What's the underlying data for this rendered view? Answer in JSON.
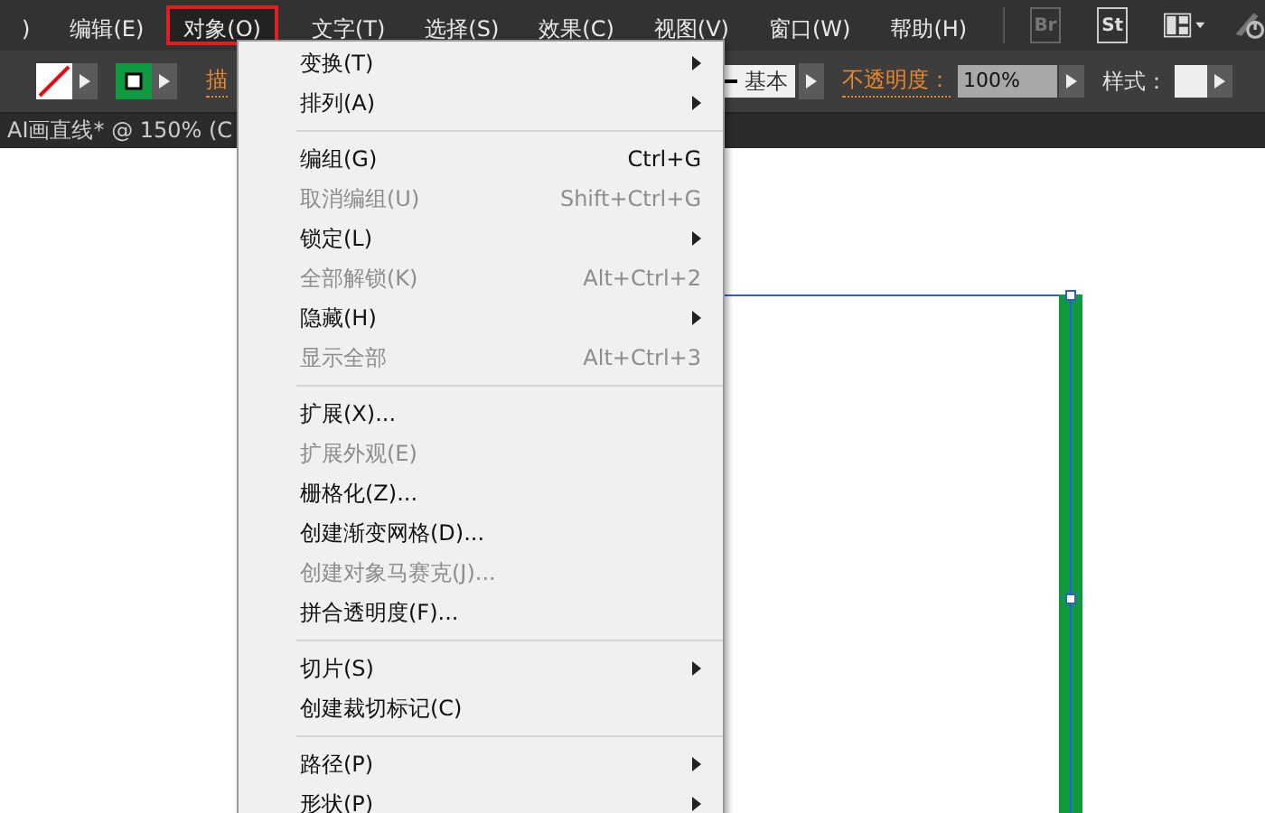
{
  "menubar": {
    "items": [
      {
        "label": ")",
        "selected": false
      },
      {
        "label": "编辑(E)",
        "selected": false
      },
      {
        "label": "对象(O)",
        "selected": true
      },
      {
        "label": "文字(T)",
        "selected": false
      },
      {
        "label": "选择(S)",
        "selected": false
      },
      {
        "label": "效果(C)",
        "selected": false
      },
      {
        "label": "视图(V)",
        "selected": false
      },
      {
        "label": "窗口(W)",
        "selected": false
      },
      {
        "label": "帮助(H)",
        "selected": false
      }
    ],
    "bridge_label": "Br",
    "stock_label": "St"
  },
  "control_bar": {
    "stroke_label": "描",
    "brush": "基本",
    "opacity_label": "不透明度：",
    "opacity_value": "100%",
    "style_label": "样式："
  },
  "document_tab": {
    "title": "AI画直线* @ 150% (C"
  },
  "menu": {
    "groups": [
      [
        {
          "label": "变换(T)",
          "disabled": false,
          "submenu": true
        },
        {
          "label": "排列(A)",
          "disabled": false,
          "submenu": true
        }
      ],
      [
        {
          "label": "编组(G)",
          "shortcut": "Ctrl+G",
          "disabled": false,
          "submenu": false
        },
        {
          "label": "取消编组(U)",
          "shortcut": "Shift+Ctrl+G",
          "disabled": true,
          "submenu": false
        },
        {
          "label": "锁定(L)",
          "disabled": false,
          "submenu": true
        },
        {
          "label": "全部解锁(K)",
          "shortcut": "Alt+Ctrl+2",
          "disabled": true,
          "submenu": false
        },
        {
          "label": "隐藏(H)",
          "disabled": false,
          "submenu": true
        },
        {
          "label": "显示全部",
          "shortcut": "Alt+Ctrl+3",
          "disabled": true,
          "submenu": false
        }
      ],
      [
        {
          "label": "扩展(X)...",
          "disabled": false,
          "submenu": false
        },
        {
          "label": "扩展外观(E)",
          "disabled": true,
          "submenu": false
        },
        {
          "label": "栅格化(Z)...",
          "disabled": false,
          "submenu": false
        },
        {
          "label": "创建渐变网格(D)...",
          "disabled": false,
          "submenu": false
        },
        {
          "label": "创建对象马赛克(J)...",
          "disabled": true,
          "submenu": false
        },
        {
          "label": "拼合透明度(F)...",
          "disabled": false,
          "submenu": false
        }
      ],
      [
        {
          "label": "切片(S)",
          "disabled": false,
          "submenu": true
        },
        {
          "label": "创建裁切标记(C)",
          "disabled": false,
          "submenu": false
        }
      ],
      [
        {
          "label": "路径(P)",
          "disabled": false,
          "submenu": true
        },
        {
          "label": "形状(P)",
          "disabled": false,
          "submenu": true
        }
      ]
    ]
  }
}
